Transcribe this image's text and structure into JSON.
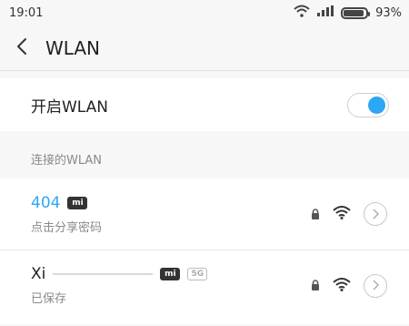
{
  "status_bar": {
    "time": "19:01",
    "battery_percent": "93%",
    "battery_level": 0.93,
    "icons": [
      "wifi-icon",
      "signal-icon",
      "battery-icon"
    ]
  },
  "header": {
    "back_icon": "chevron-left-icon",
    "title": "WLAN"
  },
  "toggle": {
    "label": "开启WLAN",
    "on": true
  },
  "section": {
    "title": "连接的WLAN"
  },
  "networks": [
    {
      "name": "404",
      "badge": "mi",
      "subtitle": "点击分享密码",
      "locked": true,
      "status": "connected"
    },
    {
      "name": "Xi",
      "badge": "mi",
      "badge2": "5G",
      "subtitle": "已保存",
      "locked": true,
      "status": "saved"
    }
  ],
  "colors": {
    "accent": "#2da7f5",
    "background": "#f7f7f7",
    "card": "#ffffff",
    "secondary_text": "#8a8a8a"
  }
}
